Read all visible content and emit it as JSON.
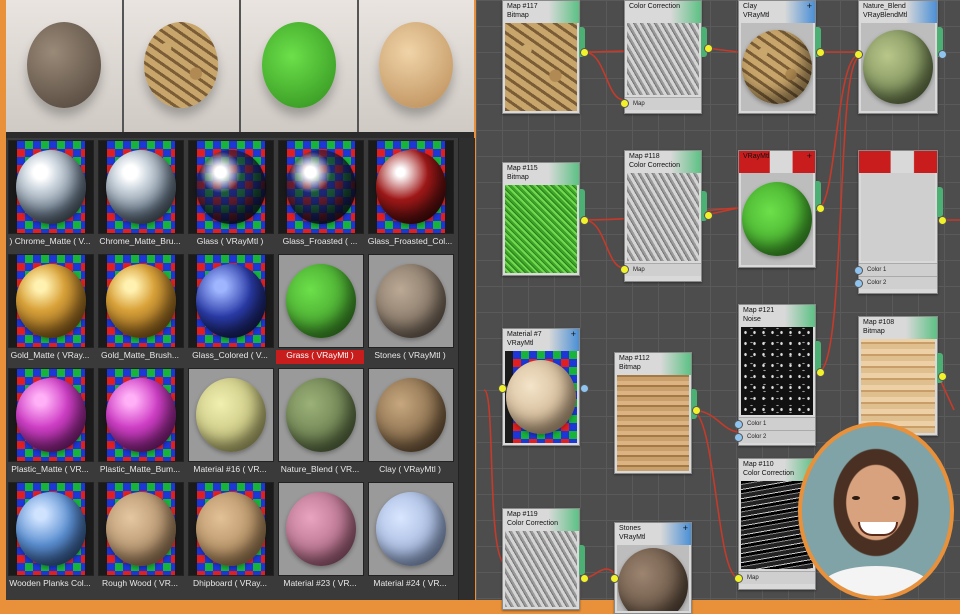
{
  "render_strip": [
    {
      "name": "stones-render",
      "texture": "stone-cracked"
    },
    {
      "name": "clay-render",
      "texture": "clay"
    },
    {
      "name": "grass-render",
      "texture": "grass"
    },
    {
      "name": "wood-render",
      "texture": "wood"
    }
  ],
  "library": {
    "items": [
      {
        "label": ")   Chrome_Matte  ( V...",
        "bg": "check",
        "ball": "chrome"
      },
      {
        "label": "Chrome_Matte_Bru...",
        "bg": "check",
        "ball": "chrome"
      },
      {
        "label": "Glass  ( VRayMtl )",
        "bg": "check",
        "ball": "glass"
      },
      {
        "label": "Glass_Froasted  ( ...",
        "bg": "check",
        "ball": "glass"
      },
      {
        "label": "Glass_Froasted_Col...",
        "bg": "check",
        "ball": "glassred"
      },
      {
        "label": "Gold_Matte  ( VRay...",
        "bg": "check",
        "ball": "gold"
      },
      {
        "label": "Gold_Matte_Brush...",
        "bg": "check",
        "ball": "gold"
      },
      {
        "label": "Glass_Colored  ( V...",
        "bg": "check",
        "ball": "glassblue"
      },
      {
        "label": "Grass  ( VRayMtl )",
        "bg": "plain",
        "ball": "grass",
        "selected": true
      },
      {
        "label": "Stones  ( VRayMtl )",
        "bg": "plain",
        "ball": "stone"
      },
      {
        "label": "Plastic_Matte  ( VR...",
        "bg": "check",
        "ball": "plastic"
      },
      {
        "label": "Plastic_Matte_Bum...",
        "bg": "check",
        "ball": "plastic"
      },
      {
        "label": "Material #16  ( VR...",
        "bg": "plain",
        "ball": "yellow"
      },
      {
        "label": "Nature_Blend  ( VR...",
        "bg": "plain",
        "ball": "nature"
      },
      {
        "label": "Clay  ( VRayMtl )",
        "bg": "plain",
        "ball": "clay"
      },
      {
        "label": "Wooden Planks Col...",
        "bg": "check",
        "ball": "bluewood"
      },
      {
        "label": "Rough Wood  ( VR...",
        "bg": "check",
        "ball": "roughwood"
      },
      {
        "label": "Dhipboard  ( VRay...",
        "bg": "check",
        "ball": "chipboard"
      },
      {
        "label": "Material #23  ( VR...",
        "bg": "plain",
        "ball": "pink"
      },
      {
        "label": "Material #24  ( VR...",
        "bg": "plain",
        "ball": "lightblue"
      }
    ]
  },
  "nodes": {
    "map117": {
      "title": "Map #117",
      "sub": "Bitmap",
      "slot": ""
    },
    "cc_top": {
      "title": "",
      "sub": "Color Correction",
      "slot": "Map"
    },
    "clay": {
      "title": "Clay",
      "sub": "VRayMtl"
    },
    "nature": {
      "title": "Nature_Blend",
      "sub": "VRayBlendMtl"
    },
    "map115": {
      "title": "Map #115",
      "sub": "Bitmap"
    },
    "map118": {
      "title": "Map #118",
      "sub": "Color Correction",
      "slot": "Map"
    },
    "grass": {
      "title": "",
      "sub": "VRayMtl"
    },
    "mix": {
      "title": "",
      "sub": "",
      "slot1": "Color 1",
      "slot2": "Color 2"
    },
    "map121": {
      "title": "Map #121",
      "sub": "Noise",
      "slot1": "Color 1",
      "slot2": "Color 2"
    },
    "map108": {
      "title": "Map #108",
      "sub": "Bitmap"
    },
    "mat7": {
      "title": "Material #7",
      "sub": "VRayMtl"
    },
    "map112": {
      "title": "Map #112",
      "sub": "Bitmap"
    },
    "map110": {
      "title": "Map #110",
      "sub": "Color Correction",
      "slot": "Map"
    },
    "map119": {
      "title": "Map #119",
      "sub": "Color Correction"
    },
    "stones": {
      "title": "Stones",
      "sub": "VRayMtl"
    }
  },
  "colors": {
    "accent_border": "#e8913a",
    "wire": "#c63a2a",
    "port_green": "#4caf74",
    "selected_label": "#c81d1d"
  }
}
